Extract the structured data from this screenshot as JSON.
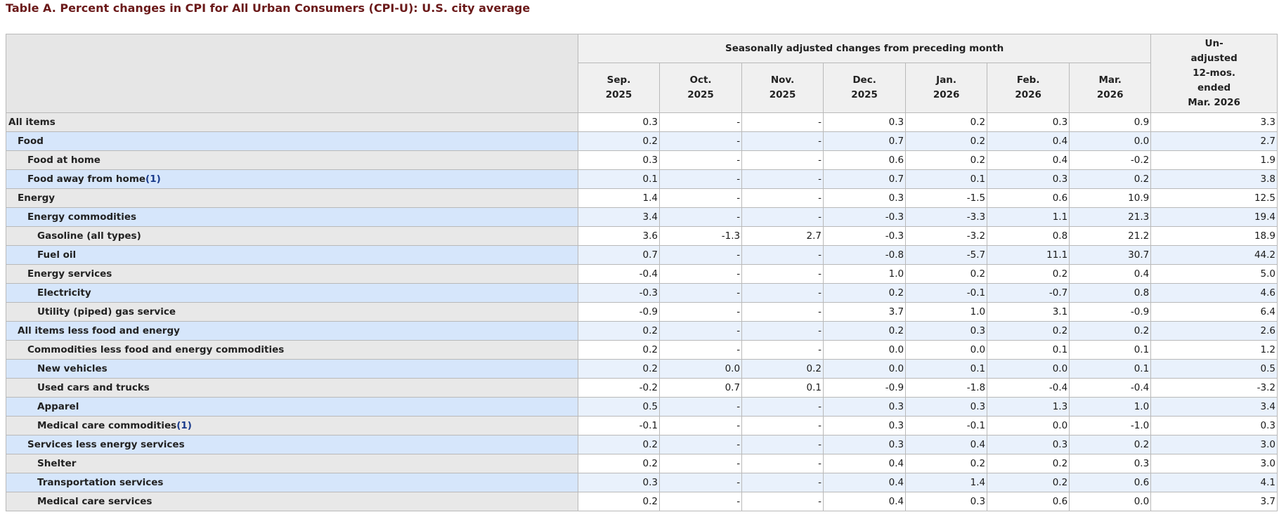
{
  "title": "Table A. Percent changes in CPI for All Urban Consumers (CPI-U): U.S. city average",
  "header": {
    "group_label": "Seasonally adjusted changes from preceding month",
    "months": [
      {
        "line1": "Sep.",
        "line2": "2025"
      },
      {
        "line1": "Oct.",
        "line2": "2025"
      },
      {
        "line1": "Nov.",
        "line2": "2025"
      },
      {
        "line1": "Dec.",
        "line2": "2025"
      },
      {
        "line1": "Jan.",
        "line2": "2026"
      },
      {
        "line1": "Feb.",
        "line2": "2026"
      },
      {
        "line1": "Mar.",
        "line2": "2026"
      }
    ],
    "unadjusted_lines": [
      "Un-",
      "adjusted",
      "12-mos.",
      "ended",
      "Mar. 2026"
    ]
  },
  "rows": [
    {
      "label": "All items",
      "level": 0,
      "footnote": "",
      "values": [
        "0.3",
        "-",
        "-",
        "0.3",
        "0.2",
        "0.3",
        "0.9",
        "3.3"
      ]
    },
    {
      "label": "Food",
      "level": 1,
      "footnote": "",
      "values": [
        "0.2",
        "-",
        "-",
        "0.7",
        "0.2",
        "0.4",
        "0.0",
        "2.7"
      ]
    },
    {
      "label": "Food at home",
      "level": 2,
      "footnote": "",
      "values": [
        "0.3",
        "-",
        "-",
        "0.6",
        "0.2",
        "0.4",
        "-0.2",
        "1.9"
      ]
    },
    {
      "label": "Food away from home",
      "level": 2,
      "footnote": "1",
      "values": [
        "0.1",
        "-",
        "-",
        "0.7",
        "0.1",
        "0.3",
        "0.2",
        "3.8"
      ]
    },
    {
      "label": "Energy",
      "level": 1,
      "footnote": "",
      "values": [
        "1.4",
        "-",
        "-",
        "0.3",
        "-1.5",
        "0.6",
        "10.9",
        "12.5"
      ]
    },
    {
      "label": "Energy commodities",
      "level": 2,
      "footnote": "",
      "values": [
        "3.4",
        "-",
        "-",
        "-0.3",
        "-3.3",
        "1.1",
        "21.3",
        "19.4"
      ]
    },
    {
      "label": "Gasoline (all types)",
      "level": 3,
      "footnote": "",
      "values": [
        "3.6",
        "-1.3",
        "2.7",
        "-0.3",
        "-3.2",
        "0.8",
        "21.2",
        "18.9"
      ]
    },
    {
      "label": "Fuel oil",
      "level": 3,
      "footnote": "",
      "values": [
        "0.7",
        "-",
        "-",
        "-0.8",
        "-5.7",
        "11.1",
        "30.7",
        "44.2"
      ]
    },
    {
      "label": "Energy services",
      "level": 2,
      "footnote": "",
      "values": [
        "-0.4",
        "-",
        "-",
        "1.0",
        "0.2",
        "0.2",
        "0.4",
        "5.0"
      ]
    },
    {
      "label": "Electricity",
      "level": 3,
      "footnote": "",
      "values": [
        "-0.3",
        "-",
        "-",
        "0.2",
        "-0.1",
        "-0.7",
        "0.8",
        "4.6"
      ]
    },
    {
      "label": "Utility (piped) gas service",
      "level": 3,
      "footnote": "",
      "values": [
        "-0.9",
        "-",
        "-",
        "3.7",
        "1.0",
        "3.1",
        "-0.9",
        "6.4"
      ]
    },
    {
      "label": "All items less food and energy",
      "level": 1,
      "footnote": "",
      "values": [
        "0.2",
        "-",
        "-",
        "0.2",
        "0.3",
        "0.2",
        "0.2",
        "2.6"
      ]
    },
    {
      "label": "Commodities less food and energy commodities",
      "level": 2,
      "footnote": "",
      "values": [
        "0.2",
        "-",
        "-",
        "0.0",
        "0.0",
        "0.1",
        "0.1",
        "1.2"
      ]
    },
    {
      "label": "New vehicles",
      "level": 3,
      "footnote": "",
      "values": [
        "0.2",
        "0.0",
        "0.2",
        "0.0",
        "0.1",
        "0.0",
        "0.1",
        "0.5"
      ]
    },
    {
      "label": "Used cars and trucks",
      "level": 3,
      "footnote": "",
      "values": [
        "-0.2",
        "0.7",
        "0.1",
        "-0.9",
        "-1.8",
        "-0.4",
        "-0.4",
        "-3.2"
      ]
    },
    {
      "label": "Apparel",
      "level": 3,
      "footnote": "",
      "values": [
        "0.5",
        "-",
        "-",
        "0.3",
        "0.3",
        "1.3",
        "1.0",
        "3.4"
      ]
    },
    {
      "label": "Medical care commodities",
      "level": 3,
      "footnote": "1",
      "values": [
        "-0.1",
        "-",
        "-",
        "0.3",
        "-0.1",
        "0.0",
        "-1.0",
        "0.3"
      ]
    },
    {
      "label": "Services less energy services",
      "level": 2,
      "footnote": "",
      "values": [
        "0.2",
        "-",
        "-",
        "0.3",
        "0.4",
        "0.3",
        "0.2",
        "3.0"
      ]
    },
    {
      "label": "Shelter",
      "level": 3,
      "footnote": "",
      "values": [
        "0.2",
        "-",
        "-",
        "0.4",
        "0.2",
        "0.2",
        "0.3",
        "3.0"
      ]
    },
    {
      "label": "Transportation services",
      "level": 3,
      "footnote": "",
      "values": [
        "0.3",
        "-",
        "-",
        "0.4",
        "1.4",
        "0.2",
        "0.6",
        "4.1"
      ]
    },
    {
      "label": "Medical care services",
      "level": 3,
      "footnote": "",
      "values": [
        "0.2",
        "-",
        "-",
        "0.4",
        "0.3",
        "0.6",
        "0.0",
        "3.7"
      ]
    }
  ]
}
